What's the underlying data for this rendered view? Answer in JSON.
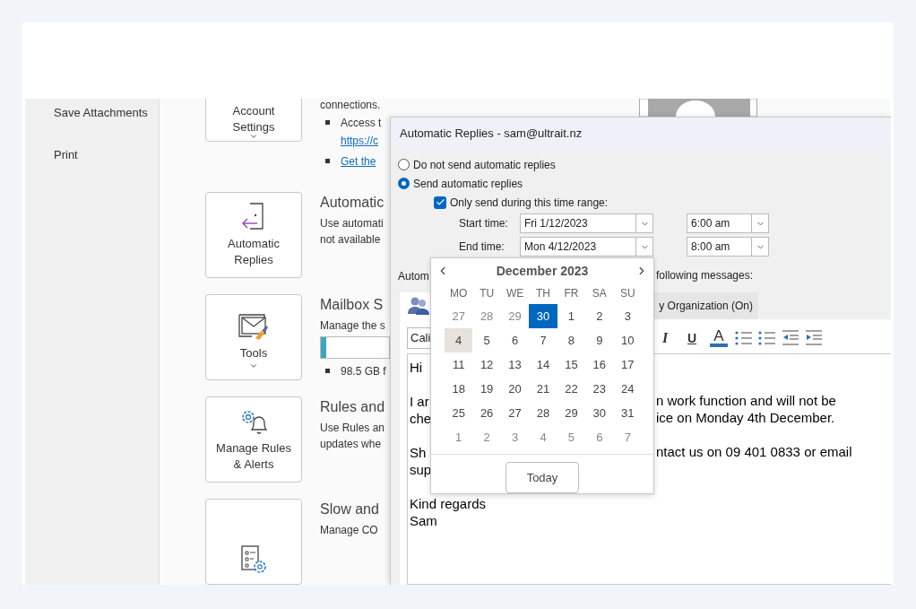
{
  "sidebar": {
    "items": [
      {
        "label": "Save Attachments"
      },
      {
        "label": "Print"
      }
    ]
  },
  "sections": [
    {
      "kind": "top",
      "card_label": "Account Settings",
      "card_caret": true,
      "lines": [
        {
          "kind": "text",
          "text": "connections."
        },
        {
          "kind": "bullet",
          "text": "Access t"
        },
        {
          "kind": "link",
          "text": "https://c"
        },
        {
          "kind": "bullet-link",
          "text": "Get the"
        }
      ]
    },
    {
      "kind": "auto-replies",
      "card_label": "Automatic Replies",
      "card_caret": false,
      "heading": "Automatic",
      "lines": [
        {
          "kind": "text",
          "text": "Use automati"
        },
        {
          "kind": "text",
          "text": "not available"
        }
      ]
    },
    {
      "kind": "tools",
      "card_label": "Tools",
      "card_caret": true,
      "heading": "Mailbox S",
      "lines": [
        {
          "kind": "text",
          "text": "Manage the s"
        },
        {
          "kind": "meter",
          "level": 0.08
        },
        {
          "kind": "bullet",
          "text": "98.5 GB f"
        }
      ]
    },
    {
      "kind": "rules",
      "card_label": "Manage Rules & Alerts",
      "card_caret": false,
      "heading": "Rules and",
      "lines": [
        {
          "kind": "text",
          "text": "Use Rules an"
        },
        {
          "kind": "text",
          "text": "updates whe"
        }
      ]
    },
    {
      "kind": "com",
      "card_caret": false,
      "heading": "Slow and",
      "lines": [
        {
          "kind": "text",
          "text": "Manage CO"
        }
      ]
    }
  ],
  "dialog": {
    "title": "Automatic Replies - sam@ultrait.nz",
    "options": [
      {
        "label": "Do not send automatic replies",
        "selected": false
      },
      {
        "label": "Send automatic replies",
        "selected": true
      }
    ],
    "time_range": {
      "label": "Only send during this time range:",
      "checked": true
    },
    "start": {
      "label": "Start time:",
      "date": "Fri 1/12/2023",
      "time": "6:00 am"
    },
    "end": {
      "label": "End time:",
      "date": "Mon 4/12/2023",
      "time": "8:00 am"
    },
    "reply_label_left": "Autom",
    "reply_label_right": "following messages:",
    "tabs": [
      {
        "selected": true
      },
      {
        "label": "y Organization (On)",
        "selected": false
      }
    ],
    "font_field": {
      "value": "Cali"
    },
    "toolbar": [
      {
        "kind": "italic",
        "label": "I"
      },
      {
        "kind": "underline",
        "label": "U"
      },
      {
        "kind": "color",
        "label": "A"
      },
      {
        "kind": "bullets"
      },
      {
        "kind": "numbering"
      },
      {
        "kind": "outdent"
      },
      {
        "kind": "indent"
      }
    ],
    "paragraphs": [
      [
        {
          "left": "Hi"
        }
      ],
      [
        {
          "left": "I ar",
          "right": "n work function and will not be"
        },
        {
          "left": "che",
          "right": "ice on Monday 4th December."
        }
      ],
      [
        {
          "left": "Sh",
          "right": "ntact us on 09 401 0833 or email"
        },
        {
          "left": "sup"
        }
      ],
      [
        {
          "left": "Kind regards"
        },
        {
          "left": "Sam"
        }
      ]
    ]
  },
  "calendar": {
    "title": "December 2023",
    "weekdays": [
      "MO",
      "TU",
      "WE",
      "TH",
      "FR",
      "SA",
      "SU"
    ],
    "weeks": [
      [
        {
          "day": "27",
          "other_month": true,
          "selected": false,
          "hovered": false
        },
        {
          "day": "28",
          "other_month": true,
          "selected": false,
          "hovered": false
        },
        {
          "day": "29",
          "other_month": true,
          "selected": false,
          "hovered": false
        },
        {
          "day": "30",
          "other_month": true,
          "selected": true,
          "hovered": false
        },
        {
          "day": "1",
          "other_month": false,
          "selected": false,
          "hovered": false
        },
        {
          "day": "2",
          "other_month": false,
          "selected": false,
          "hovered": false
        },
        {
          "day": "3",
          "other_month": false,
          "selected": false,
          "hovered": false
        }
      ],
      [
        {
          "day": "4",
          "other_month": false,
          "selected": false,
          "hovered": true
        },
        {
          "day": "5",
          "other_month": false,
          "selected": false,
          "hovered": false
        },
        {
          "day": "6",
          "other_month": false,
          "selected": false,
          "hovered": false
        },
        {
          "day": "7",
          "other_month": false,
          "selected": false,
          "hovered": false
        },
        {
          "day": "8",
          "other_month": false,
          "selected": false,
          "hovered": false
        },
        {
          "day": "9",
          "other_month": false,
          "selected": false,
          "hovered": false
        },
        {
          "day": "10",
          "other_month": false,
          "selected": false,
          "hovered": false
        }
      ],
      [
        {
          "day": "11",
          "other_month": false,
          "selected": false,
          "hovered": false
        },
        {
          "day": "12",
          "other_month": false,
          "selected": false,
          "hovered": false
        },
        {
          "day": "13",
          "other_month": false,
          "selected": false,
          "hovered": false
        },
        {
          "day": "14",
          "other_month": false,
          "selected": false,
          "hovered": false
        },
        {
          "day": "15",
          "other_month": false,
          "selected": false,
          "hovered": false
        },
        {
          "day": "16",
          "other_month": false,
          "selected": false,
          "hovered": false
        },
        {
          "day": "17",
          "other_month": false,
          "selected": false,
          "hovered": false
        }
      ],
      [
        {
          "day": "18",
          "other_month": false,
          "selected": false,
          "hovered": false
        },
        {
          "day": "19",
          "other_month": false,
          "selected": false,
          "hovered": false
        },
        {
          "day": "20",
          "other_month": false,
          "selected": false,
          "hovered": false
        },
        {
          "day": "21",
          "other_month": false,
          "selected": false,
          "hovered": false
        },
        {
          "day": "22",
          "other_month": false,
          "selected": false,
          "hovered": false
        },
        {
          "day": "23",
          "other_month": false,
          "selected": false,
          "hovered": false
        },
        {
          "day": "24",
          "other_month": false,
          "selected": false,
          "hovered": false
        }
      ],
      [
        {
          "day": "25",
          "other_month": false,
          "selected": false,
          "hovered": false
        },
        {
          "day": "26",
          "other_month": false,
          "selected": false,
          "hovered": false
        },
        {
          "day": "27",
          "other_month": false,
          "selected": false,
          "hovered": false
        },
        {
          "day": "28",
          "other_month": false,
          "selected": false,
          "hovered": false
        },
        {
          "day": "29",
          "other_month": false,
          "selected": false,
          "hovered": false
        },
        {
          "day": "30",
          "other_month": false,
          "selected": false,
          "hovered": false
        },
        {
          "day": "31",
          "other_month": false,
          "selected": false,
          "hovered": false
        }
      ],
      [
        {
          "day": "1",
          "other_month": true,
          "selected": false,
          "hovered": false
        },
        {
          "day": "2",
          "other_month": true,
          "selected": false,
          "hovered": false
        },
        {
          "day": "3",
          "other_month": true,
          "selected": false,
          "hovered": false
        },
        {
          "day": "4",
          "other_month": true,
          "selected": false,
          "hovered": false
        },
        {
          "day": "5",
          "other_month": true,
          "selected": false,
          "hovered": false
        },
        {
          "day": "6",
          "other_month": true,
          "selected": false,
          "hovered": false
        },
        {
          "day": "7",
          "other_month": true,
          "selected": false,
          "hovered": false
        }
      ]
    ],
    "today_button": "Today"
  }
}
